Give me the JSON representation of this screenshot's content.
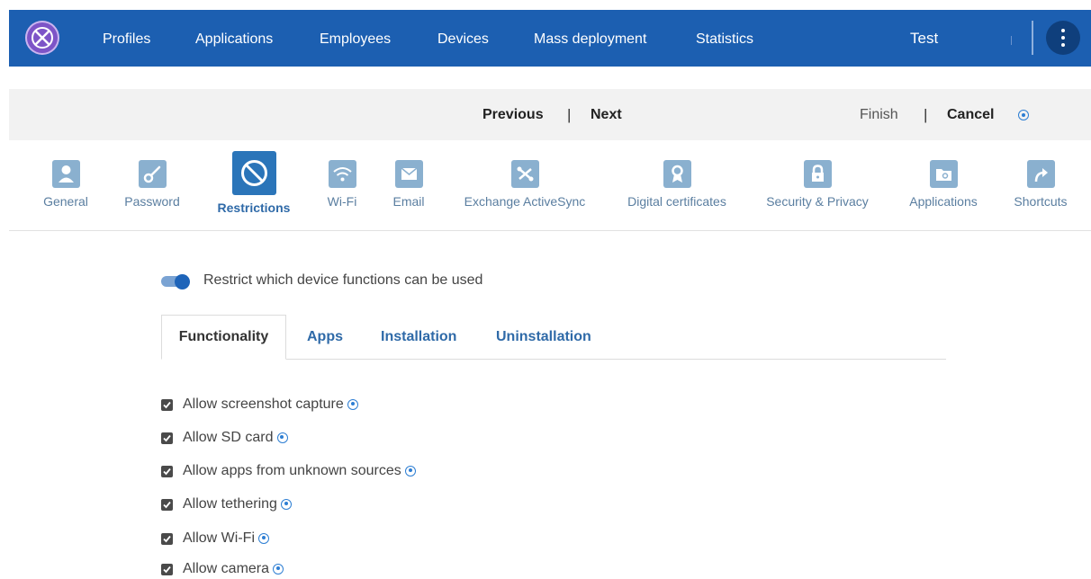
{
  "nav": {
    "items": [
      "Profiles",
      "Applications",
      "Employees",
      "Devices",
      "Mass deployment",
      "Statistics"
    ],
    "user": "Test",
    "logo_icon": "app-logo-icon",
    "menu_icon": "kebab-menu-icon"
  },
  "actions": {
    "previous": "Previous",
    "next": "Next",
    "finish": "Finish",
    "cancel": "Cancel",
    "separator": "|"
  },
  "steps": [
    {
      "label": "General",
      "icon": "person-icon"
    },
    {
      "label": "Password",
      "icon": "key-icon"
    },
    {
      "label": "Restrictions",
      "icon": "no-entry-icon",
      "active": true
    },
    {
      "label": "Wi-Fi",
      "icon": "wifi-icon"
    },
    {
      "label": "Email",
      "icon": "envelope-icon"
    },
    {
      "label": "Exchange ActiveSync",
      "icon": "sync-icon"
    },
    {
      "label": "Digital certificates",
      "icon": "certificate-icon"
    },
    {
      "label": "Security & Privacy",
      "icon": "lock-icon"
    },
    {
      "label": "Applications",
      "icon": "folder-icon"
    },
    {
      "label": "Shortcuts",
      "icon": "share-arrow-icon"
    }
  ],
  "restrict": {
    "label": "Restrict which device functions can be used",
    "enabled": true
  },
  "tabs": [
    "Functionality",
    "Apps",
    "Installation",
    "Uninstallation"
  ],
  "active_tab": "Functionality",
  "options": [
    {
      "label": "Allow screenshot capture",
      "checked": true
    },
    {
      "label": "Allow SD card",
      "checked": true
    },
    {
      "label": "Allow apps from unknown sources",
      "checked": true
    },
    {
      "label": "Allow tethering",
      "checked": true
    },
    {
      "label": "Allow Wi-Fi",
      "checked": true
    },
    {
      "label": "Allow camera",
      "checked": true
    }
  ],
  "colors": {
    "nav_bg": "#1c5fb1",
    "accent": "#2b75b9",
    "step_icon": "#8ab0cf",
    "logo": "#7d54c7"
  }
}
